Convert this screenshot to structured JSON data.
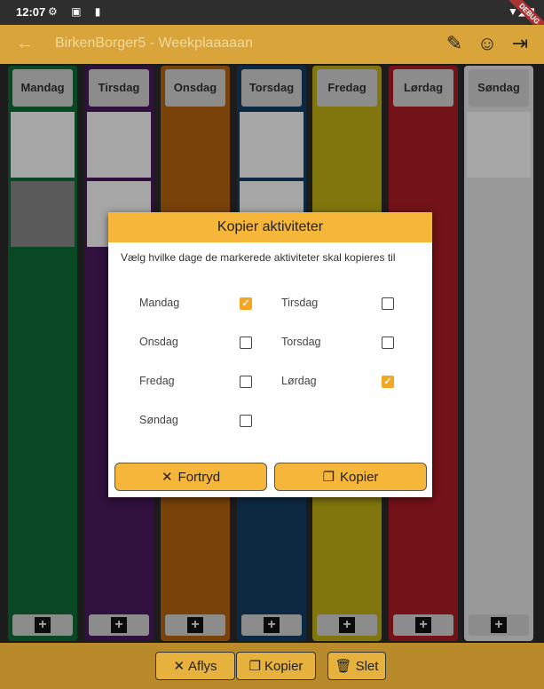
{
  "status": {
    "time": "12:07",
    "debug": "DEBUG"
  },
  "appbar": {
    "title": "BirkenBorger5 - Weekplaaaaan"
  },
  "days": [
    {
      "label": "Mandag",
      "color": "#0f6f3a"
    },
    {
      "label": "Tirsdag",
      "color": "#4b1a5e"
    },
    {
      "label": "Onsdag",
      "color": "#b8660f"
    },
    {
      "label": "Torsdag",
      "color": "#154066"
    },
    {
      "label": "Fredag",
      "color": "#c7b414"
    },
    {
      "label": "Lørdag",
      "color": "#b11d26"
    },
    {
      "label": "Søndag",
      "color": "#ececec"
    }
  ],
  "bottom": {
    "cancel": "Aflys",
    "copy": "Kopier",
    "delete": "Slet"
  },
  "dialog": {
    "title": "Kopier aktiviteter",
    "subtitle": "Vælg hvilke dage de markerede aktiviteter skal kopieres til",
    "options": [
      {
        "label": "Mandag",
        "checked": true
      },
      {
        "label": "Tirsdag",
        "checked": false
      },
      {
        "label": "Onsdag",
        "checked": false
      },
      {
        "label": "Torsdag",
        "checked": false
      },
      {
        "label": "Fredag",
        "checked": false
      },
      {
        "label": "Lørdag",
        "checked": true
      },
      {
        "label": "Søndag",
        "checked": false
      }
    ],
    "cancel_label": "Fortryd",
    "copy_label": "Kopier"
  }
}
